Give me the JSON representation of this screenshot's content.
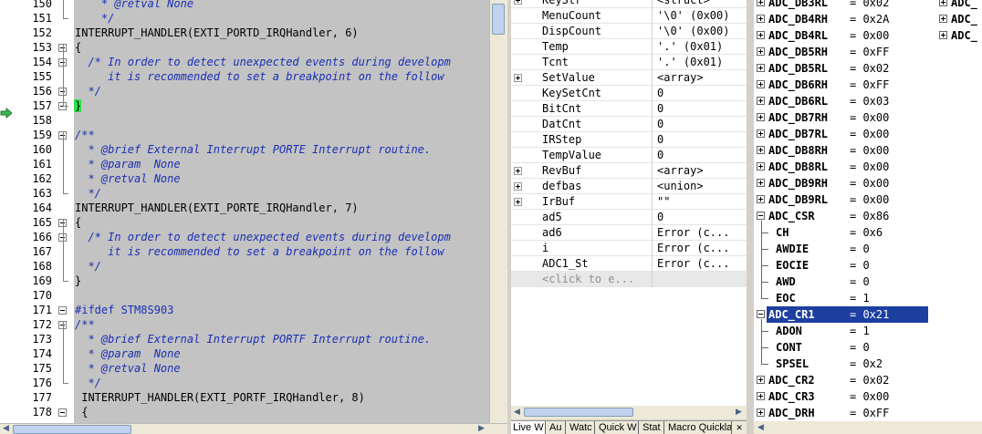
{
  "editor": {
    "execution_line": "157",
    "lines": [
      {
        "n": "150",
        "text": "    * @retval None",
        "cls": "cmt"
      },
      {
        "n": "151",
        "text": "    */",
        "cls": "cmt"
      },
      {
        "n": "152",
        "text": "INTERRUPT_HANDLER(EXTI_PORTD_IRQHandler, 6)",
        "cls": ""
      },
      {
        "n": "153",
        "text": "{",
        "cls": ""
      },
      {
        "n": "154",
        "text": "  /* In order to detect unexpected events during developm",
        "cls": "cmt"
      },
      {
        "n": "155",
        "text": "     it is recommended to set a breakpoint on the follow",
        "cls": "cmt"
      },
      {
        "n": "156",
        "text": "  */",
        "cls": "cmt"
      },
      {
        "n": "157",
        "text": "}",
        "cls": ""
      },
      {
        "n": "158",
        "text": "",
        "cls": ""
      },
      {
        "n": "159",
        "text": "/**",
        "cls": "cmt"
      },
      {
        "n": "160",
        "text": "  * @brief External Interrupt PORTE Interrupt routine.",
        "cls": "cmt"
      },
      {
        "n": "161",
        "text": "  * @param  None",
        "cls": "cmt"
      },
      {
        "n": "162",
        "text": "  * @retval None",
        "cls": "cmt"
      },
      {
        "n": "163",
        "text": "  */",
        "cls": "cmt"
      },
      {
        "n": "164",
        "text": "INTERRUPT_HANDLER(EXTI_PORTE_IRQHandler, 7)",
        "cls": ""
      },
      {
        "n": "165",
        "text": "{",
        "cls": ""
      },
      {
        "n": "166",
        "text": "  /* In order to detect unexpected events during developm",
        "cls": "cmt"
      },
      {
        "n": "167",
        "text": "     it is recommended to set a breakpoint on the follow",
        "cls": "cmt"
      },
      {
        "n": "168",
        "text": "  */",
        "cls": "cmt"
      },
      {
        "n": "169",
        "text": "}",
        "cls": ""
      },
      {
        "n": "170",
        "text": "",
        "cls": ""
      },
      {
        "n": "171",
        "text": "#ifdef STM8S903",
        "cls": "pre"
      },
      {
        "n": "172",
        "text": "/**",
        "cls": "cmt"
      },
      {
        "n": "173",
        "text": "  * @brief External Interrupt PORTF Interrupt routine.",
        "cls": "cmt"
      },
      {
        "n": "174",
        "text": "  * @param  None",
        "cls": "cmt"
      },
      {
        "n": "175",
        "text": "  * @retval None",
        "cls": "cmt"
      },
      {
        "n": "176",
        "text": "  */",
        "cls": "cmt"
      },
      {
        "n": "177",
        "text": " INTERRUPT_HANDLER(EXTI_PORTF_IRQHandler, 8)",
        "cls": ""
      },
      {
        "n": "178",
        "text": " {",
        "cls": ""
      }
    ]
  },
  "live_watch": {
    "rows": [
      {
        "name": "KeyStr",
        "value": "<struct>",
        "expand": true
      },
      {
        "name": "MenuCount",
        "value": "'\\0' (0x00)",
        "expand": false
      },
      {
        "name": "DispCount",
        "value": "'\\0' (0x00)",
        "expand": false
      },
      {
        "name": "Temp",
        "value": "'.' (0x01)",
        "expand": false
      },
      {
        "name": "Tcnt",
        "value": "'.' (0x01)",
        "expand": false
      },
      {
        "name": "SetValue",
        "value": "<array>",
        "expand": true
      },
      {
        "name": "KeySetCnt",
        "value": "0",
        "expand": false
      },
      {
        "name": "BitCnt",
        "value": "0",
        "expand": false
      },
      {
        "name": "DatCnt",
        "value": "0",
        "expand": false
      },
      {
        "name": "IRStep",
        "value": "0",
        "expand": false
      },
      {
        "name": "TempValue",
        "value": "0",
        "expand": false
      },
      {
        "name": "RevBuf",
        "value": "<array>",
        "expand": true
      },
      {
        "name": "defbas",
        "value": "<union>",
        "expand": true
      },
      {
        "name": "IrBuf",
        "value": "\"\"",
        "expand": true
      },
      {
        "name": "ad5",
        "value": "0",
        "expand": false
      },
      {
        "name": "ad6",
        "value": "Error (c...",
        "expand": false
      },
      {
        "name": "i",
        "value": "Error (c...",
        "expand": false
      },
      {
        "name": "ADC1_St",
        "value": "Error (c...",
        "expand": false
      }
    ],
    "placeholder": "<click to e...",
    "tabs": [
      "Live W",
      "Au",
      "Watc",
      "Quick W",
      "Stat",
      "Macro Quickla"
    ],
    "close_glyph": "✕"
  },
  "registers": {
    "rows": [
      {
        "name": "ADC_DB3RL",
        "value": "= 0x02",
        "kind": "plus"
      },
      {
        "name": "ADC_DB4RH",
        "value": "= 0x2A",
        "kind": "plus"
      },
      {
        "name": "ADC_DB4RL",
        "value": "= 0x00",
        "kind": "plus"
      },
      {
        "name": "ADC_DB5RH",
        "value": "= 0xFF",
        "kind": "plus"
      },
      {
        "name": "ADC_DB5RL",
        "value": "= 0x02",
        "kind": "plus"
      },
      {
        "name": "ADC_DB6RH",
        "value": "= 0xFF",
        "kind": "plus"
      },
      {
        "name": "ADC_DB6RL",
        "value": "= 0x03",
        "kind": "plus"
      },
      {
        "name": "ADC_DB7RH",
        "value": "= 0x00",
        "kind": "plus"
      },
      {
        "name": "ADC_DB7RL",
        "value": "= 0x00",
        "kind": "plus"
      },
      {
        "name": "ADC_DB8RH",
        "value": "= 0x00",
        "kind": "plus"
      },
      {
        "name": "ADC_DB8RL",
        "value": "= 0x00",
        "kind": "plus"
      },
      {
        "name": "ADC_DB9RH",
        "value": "= 0x00",
        "kind": "plus"
      },
      {
        "name": "ADC_DB9RL",
        "value": "= 0x00",
        "kind": "plus"
      },
      {
        "name": "ADC_CSR",
        "value": "= 0x86",
        "kind": "minus"
      },
      {
        "name": "CH",
        "value": "= 0x6",
        "kind": "child"
      },
      {
        "name": "AWDIE",
        "value": "= 0",
        "kind": "child"
      },
      {
        "name": "EOCIE",
        "value": "= 0",
        "kind": "child"
      },
      {
        "name": "AWD",
        "value": "= 0",
        "kind": "child"
      },
      {
        "name": "EOC",
        "value": "= 1",
        "kind": "child"
      },
      {
        "name": "ADC_CR1",
        "value": "= 0x21",
        "kind": "minus-sel"
      },
      {
        "name": "ADON",
        "value": "= 1",
        "kind": "child"
      },
      {
        "name": "CONT",
        "value": "= 0",
        "kind": "child"
      },
      {
        "name": "SPSEL",
        "value": "= 0x2",
        "kind": "child"
      },
      {
        "name": "ADC_CR2",
        "value": "= 0x02",
        "kind": "plus"
      },
      {
        "name": "ADC_CR3",
        "value": "= 0x00",
        "kind": "plus"
      },
      {
        "name": "ADC_DRH",
        "value": "= 0xFF",
        "kind": "plus"
      }
    ],
    "col2": [
      {
        "name": "ADC_"
      },
      {
        "name": "ADC_"
      },
      {
        "name": "ADC_"
      }
    ]
  },
  "scroll_glyphs": {
    "left": "◀",
    "right": "▶",
    "up": "▲",
    "down": "▼"
  }
}
